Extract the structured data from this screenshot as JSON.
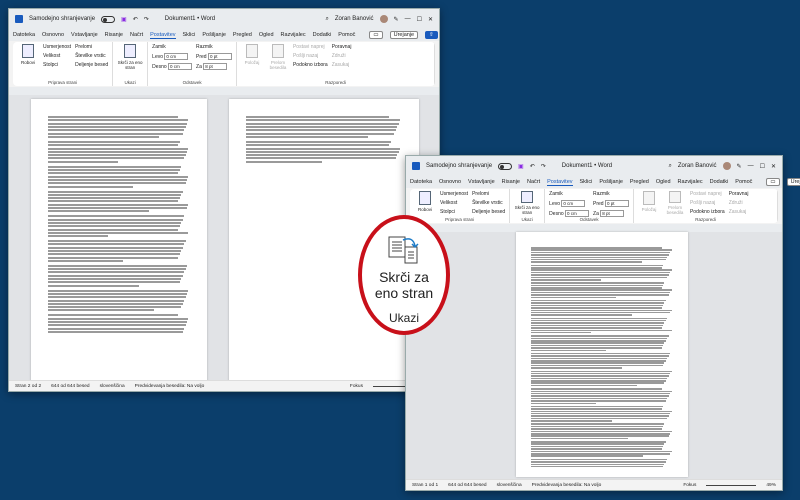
{
  "app": {
    "autosave_label": "Samodejno shranjevanje",
    "doc_title": "Dokument1 • Word",
    "user": "Zoran Banović",
    "brand_color": "#185abd",
    "callout_color": "#c8101a"
  },
  "tabs": [
    "Datoteka",
    "Osnovno",
    "Vstavljanje",
    "Risanje",
    "Načrt",
    "Postavitev",
    "Sklici",
    "Pošiljanje",
    "Pregled",
    "Ogled",
    "Razvijalec",
    "Dodatki",
    "Pomoč"
  ],
  "active_tab": "Postavitev",
  "header_buttons": {
    "comment": "▭",
    "editing": "Urejanje",
    "share": "⇧"
  },
  "ribbon": {
    "page_setup": {
      "label": "Priprava strani",
      "margins": "Robovi",
      "orientation": "Usmerjenost",
      "size": "Velikost",
      "columns": "Stolpci",
      "breaks": "Prelomi",
      "line_numbers": "Številke vrstic",
      "hyphenation": "Deljenje besed"
    },
    "commands": {
      "label": "Ukazi",
      "shrink": "Skrči za eno stran"
    },
    "paragraph": {
      "label": "Odstavek",
      "indent": "Zamik",
      "spacing": "Razmik",
      "left": "Levo",
      "right": "Desno",
      "before": "Pred",
      "after": "Za",
      "left_val": "0 cm",
      "right_val": "0 cm",
      "before_val": "0 pt",
      "after_val": "8 pt"
    },
    "arrange": {
      "label": "Razporedi",
      "position": "Položaj",
      "wrap": "Prelom besedila",
      "forward": "Postavi naprej",
      "backward": "Pošlji nazaj",
      "selection": "Podokno izbora",
      "align": "Poravnaj",
      "group": "Združi",
      "rotate": "Zasukaj"
    }
  },
  "status_before": {
    "page": "Stran 2 od 2",
    "words": "644 od 644 besed",
    "language": "slovenščina",
    "predictions": "Predvidevanja besedila: Na voljo",
    "focus": "Fokus"
  },
  "status_after": {
    "page": "Stran 1 od 1",
    "words": "644 od 644 besed",
    "language": "slovenščina",
    "predictions": "Predvidevanja besedila: Na voljo",
    "focus": "Fokus",
    "zoom": "49%"
  },
  "callout": {
    "line1": "Skrči za",
    "line2": "eno stran",
    "group": "Ukazi"
  }
}
